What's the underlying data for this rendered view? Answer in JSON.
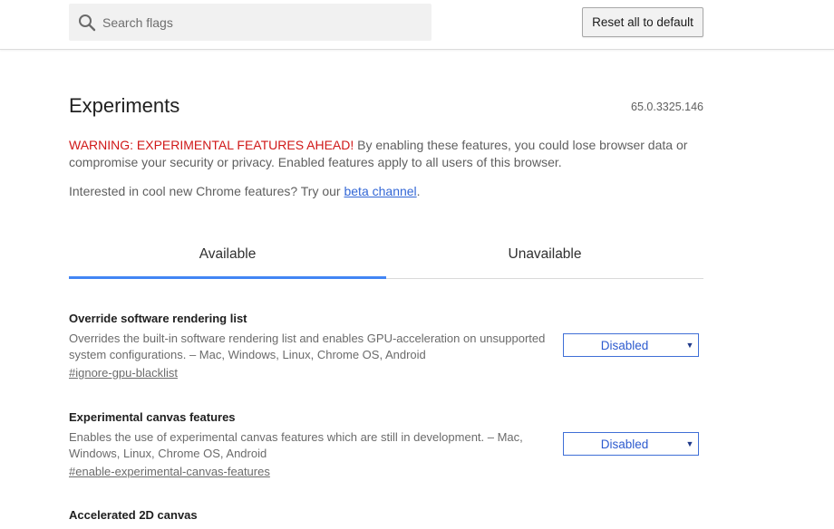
{
  "header": {
    "search_placeholder": "Search flags",
    "reset_label": "Reset all to default"
  },
  "page": {
    "title": "Experiments",
    "version": "65.0.3325.146",
    "warning_prefix": "WARNING: EXPERIMENTAL FEATURES AHEAD!",
    "warning_body": " By enabling these features, you could lose browser data or compromise your security or privacy. Enabled features apply to all users of this browser.",
    "interested_text": "Interested in cool new Chrome features? Try our ",
    "beta_link": "beta channel",
    "interested_end": "."
  },
  "tabs": [
    {
      "label": "Available",
      "active": true
    },
    {
      "label": "Unavailable",
      "active": false
    }
  ],
  "flags": [
    {
      "name": "Override software rendering list",
      "description": "Overrides the built-in software rendering list and enables GPU-acceleration on unsupported system configurations. – Mac, Windows, Linux, Chrome OS, Android",
      "link": "#ignore-gpu-blacklist",
      "value": "Disabled"
    },
    {
      "name": "Experimental canvas features",
      "description": "Enables the use of experimental canvas features which are still in development. – Mac, Windows, Linux, Chrome OS, Android",
      "link": "#enable-experimental-canvas-features",
      "value": "Disabled"
    },
    {
      "name": "Accelerated 2D canvas"
    }
  ],
  "colors": {
    "accent": "#4285f4",
    "warning": "#d01818",
    "link": "#3367d6"
  }
}
